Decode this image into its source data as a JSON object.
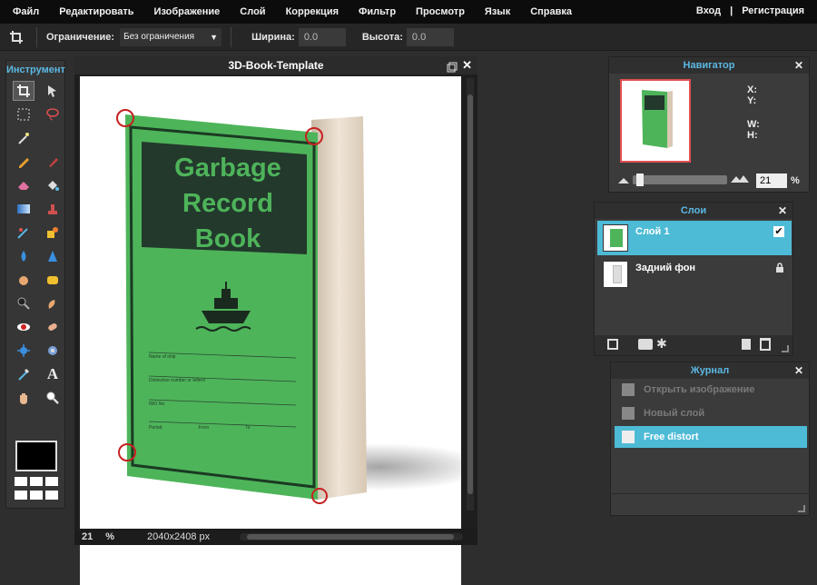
{
  "menu": {
    "items": [
      "Файл",
      "Редактировать",
      "Изображение",
      "Слой",
      "Коррекция",
      "Фильтр",
      "Просмотр",
      "Язык",
      "Справка"
    ],
    "login": "Вход",
    "separator": "|",
    "register": "Регистрация"
  },
  "toolbar": {
    "constraint_label": "Ограничение:",
    "constraint_value": "Без ограничения",
    "width_label": "Ширина:",
    "width_value": "0.0",
    "height_label": "Высота:",
    "height_value": "0.0"
  },
  "tools_panel": {
    "title": "Инструмент"
  },
  "canvas": {
    "title": "3D-Book-Template",
    "zoom": "21",
    "zoom_unit": "%",
    "dimensions": "2040x2408 px"
  },
  "book": {
    "title_lines": [
      "Garbage",
      "Record",
      "Book"
    ],
    "form_fields": [
      "Name of ship",
      "Distinctive number or letters",
      "IMO No",
      "Period",
      "From",
      "To"
    ]
  },
  "navigator": {
    "title": "Навигатор",
    "x_label": "X:",
    "y_label": "Y:",
    "w_label": "W:",
    "h_label": "H:",
    "zoom": "21",
    "zoom_unit": "%"
  },
  "layers": {
    "title": "Слои",
    "items": [
      {
        "name": "Слой 1",
        "selected": true
      },
      {
        "name": "Задний фон",
        "locked": true
      }
    ]
  },
  "history": {
    "title": "Журнал",
    "items": [
      "Открыть изображение",
      "Новый слой",
      "Free distort"
    ]
  },
  "colors": {
    "accent": "#5bb8e3",
    "book_green": "#4eb45a",
    "selection": "#4dbbd6"
  }
}
